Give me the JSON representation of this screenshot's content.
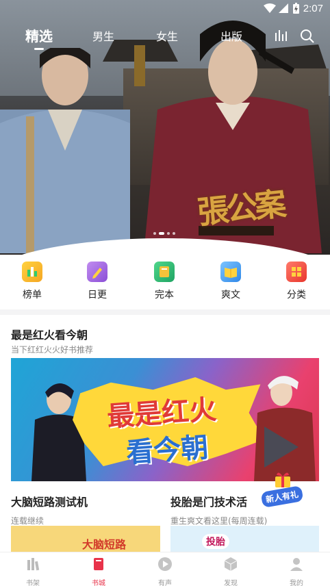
{
  "status_bar": {
    "time": "2:07"
  },
  "top_nav": {
    "tabs": [
      {
        "label": "精选",
        "active": true
      },
      {
        "label": "男生",
        "active": false
      },
      {
        "label": "女生",
        "active": false
      },
      {
        "label": "出版",
        "active": false
      }
    ],
    "icons": [
      "ranking-bars-icon",
      "search-icon"
    ]
  },
  "hero": {
    "calligraphy_title": "張公案",
    "page_dots": 4,
    "active_dot": 1
  },
  "categories": [
    {
      "label": "榜单",
      "icon": "ranking-icon",
      "color": "#f5a623"
    },
    {
      "label": "日更",
      "icon": "pencil-icon",
      "color": "#9b59d6"
    },
    {
      "label": "完本",
      "icon": "book-icon",
      "color": "#2bb673"
    },
    {
      "label": "爽文",
      "icon": "open-book-icon",
      "color": "#3aa0f0"
    },
    {
      "label": "分类",
      "icon": "grid-icon",
      "color": "#f0483e"
    }
  ],
  "section": {
    "title": "最是红火看今朝",
    "subtitle": "当下红红火火好书推荐",
    "banner_line1": "最是红火",
    "banner_line2": "看今朝"
  },
  "books": [
    {
      "title": "大脑短路测试机",
      "subtitle": "连载继续",
      "cover_text": "大脑短路"
    },
    {
      "title": "投胎是门技术活",
      "subtitle": "重生爽文看这里(每周连载)",
      "cover_text": "投胎"
    }
  ],
  "gift_badge": "新人有礼",
  "bottom_nav": [
    {
      "label": "书架",
      "icon": "bookshelf-icon",
      "active": false
    },
    {
      "label": "书城",
      "icon": "bookstore-icon",
      "active": true
    },
    {
      "label": "有声",
      "icon": "play-icon",
      "active": false
    },
    {
      "label": "发现",
      "icon": "cube-icon",
      "active": false
    },
    {
      "label": "我的",
      "icon": "profile-icon",
      "active": false
    }
  ],
  "colors": {
    "accent": "#e8334a",
    "gold": "#d9a441"
  }
}
